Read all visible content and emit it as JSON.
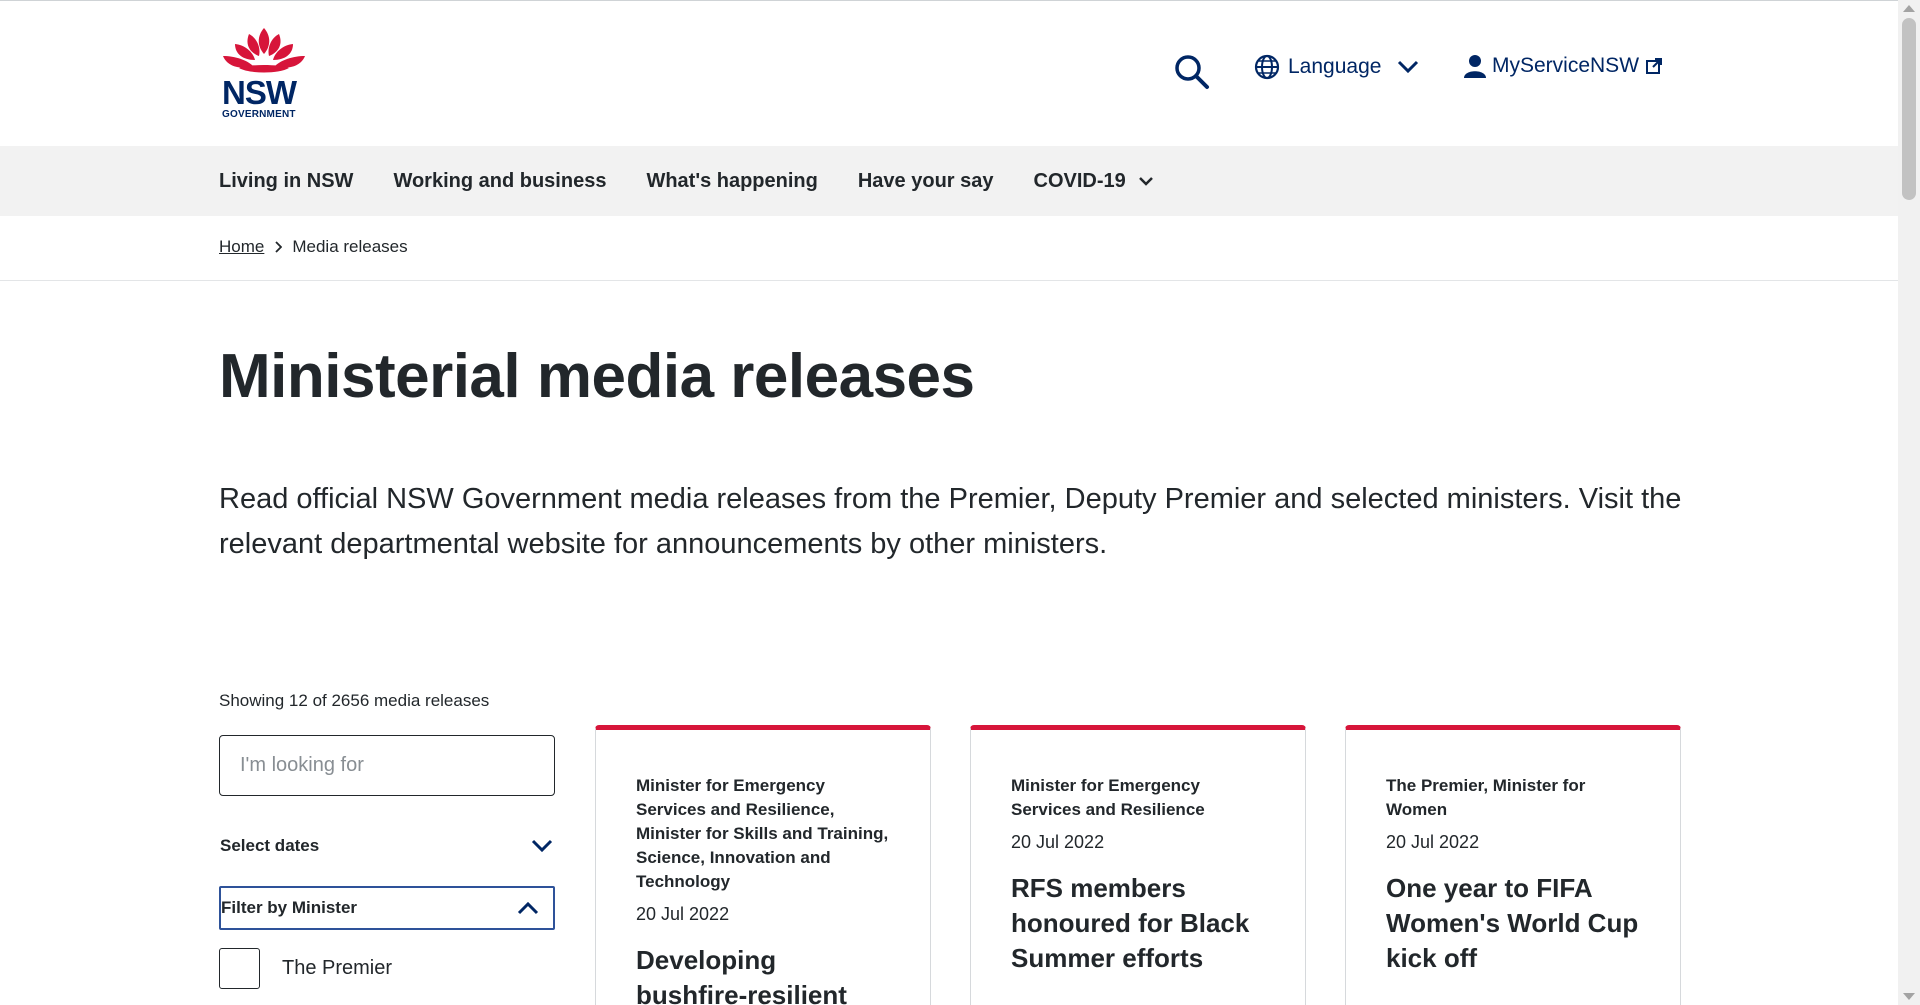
{
  "header": {
    "logo_wordmark": "NSW",
    "logo_sub": "GOVERNMENT",
    "language_label": "Language",
    "myservice_label": "MyServiceNSW"
  },
  "nav": {
    "items": [
      {
        "label": "Living in NSW"
      },
      {
        "label": "Working and business"
      },
      {
        "label": "What's happening"
      },
      {
        "label": "Have your say"
      },
      {
        "label": "COVID-19"
      }
    ]
  },
  "breadcrumb": {
    "home": "Home",
    "current": "Media releases"
  },
  "page": {
    "title": "Ministerial media releases",
    "intro": "Read official NSW Government media releases from the Premier, Deputy Premier and selected ministers. Visit the relevant departmental website for announcements by other ministers."
  },
  "filters": {
    "showing": "Showing 12 of 2656 media releases",
    "search_placeholder": "I'm looking for",
    "dates_label": "Select dates",
    "minister_label": "Filter by Minister",
    "options": [
      {
        "label": "The Premier"
      }
    ]
  },
  "cards": [
    {
      "minister": "Minister for Emergency Services and Resilience, Minister for Skills and Training, Science, Innovation and Technology",
      "date": "20 Jul 2022",
      "headline": "Developing bushfire-resilient technology"
    },
    {
      "minister": "Minister for Emergency Services and Resilience",
      "date": "20 Jul 2022",
      "headline": "RFS members honoured for Black Summer efforts"
    },
    {
      "minister": "The Premier, Minister for Women",
      "date": "20 Jul 2022",
      "headline": "One year to FIFA Women's World Cup kick off"
    }
  ],
  "colors": {
    "brand_navy": "#002664",
    "brand_red": "#d7153a",
    "focus_blue": "#2e5299"
  }
}
